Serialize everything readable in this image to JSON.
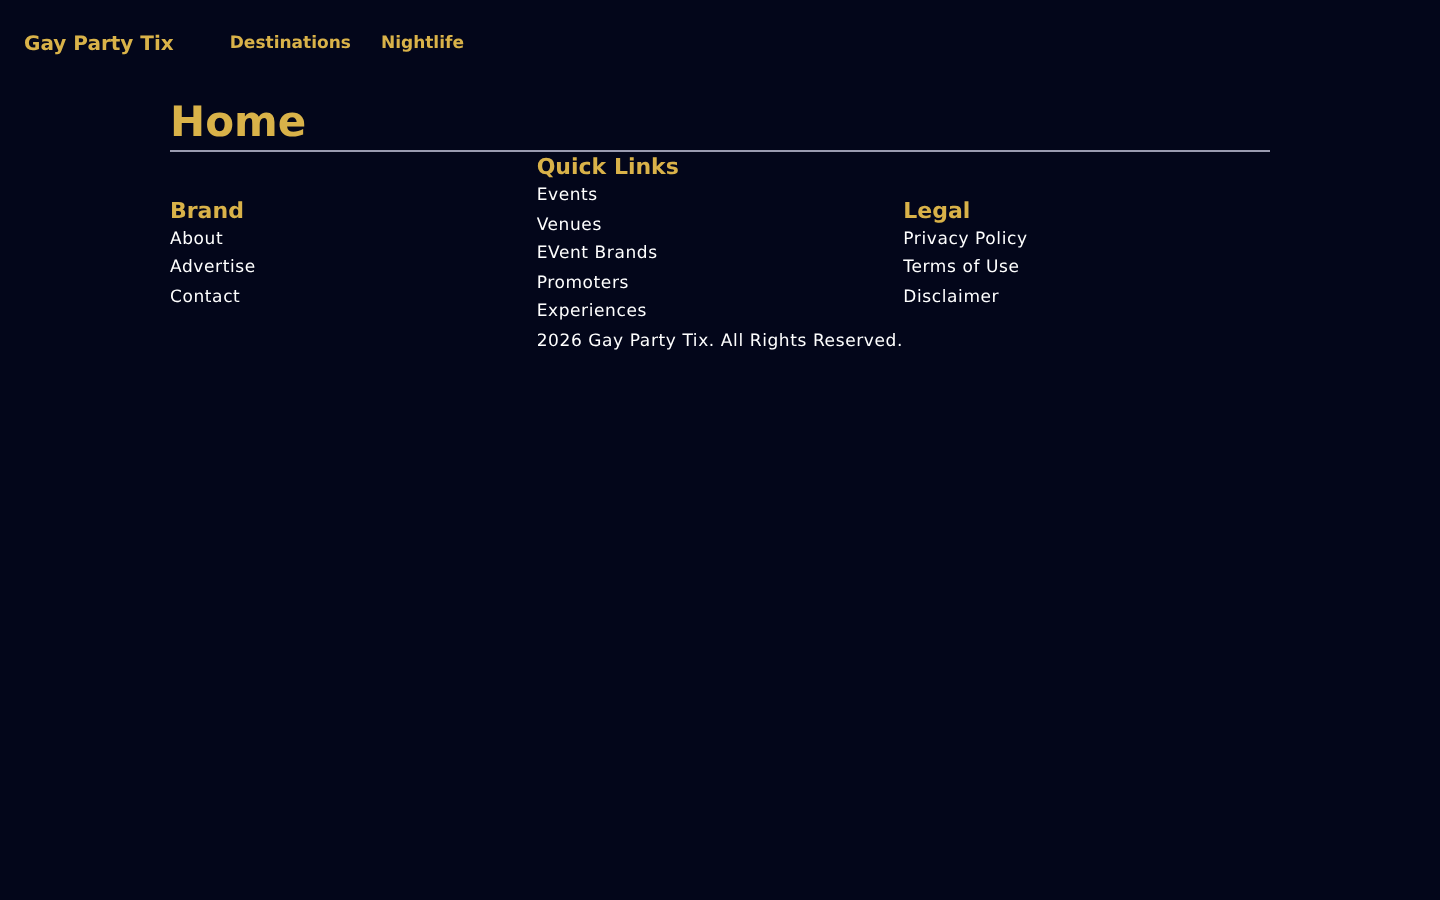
{
  "nav": {
    "brand": "Gay Party Tix",
    "links": [
      "Destinations",
      "Nightlife"
    ]
  },
  "page": {
    "title": "Home"
  },
  "footer": {
    "columns": [
      {
        "heading": "Brand",
        "links": [
          "About",
          "Advertise",
          "Contact"
        ]
      },
      {
        "heading": "Quick Links",
        "links": [
          "Events",
          "Venues",
          "EVent Brands",
          "Promoters",
          "Experiences"
        ],
        "note": "2026 Gay Party Tix. All Rights Reserved."
      },
      {
        "heading": "Legal",
        "links": [
          "Privacy Policy",
          "Terms of Use",
          "Disclaimer"
        ]
      }
    ]
  }
}
